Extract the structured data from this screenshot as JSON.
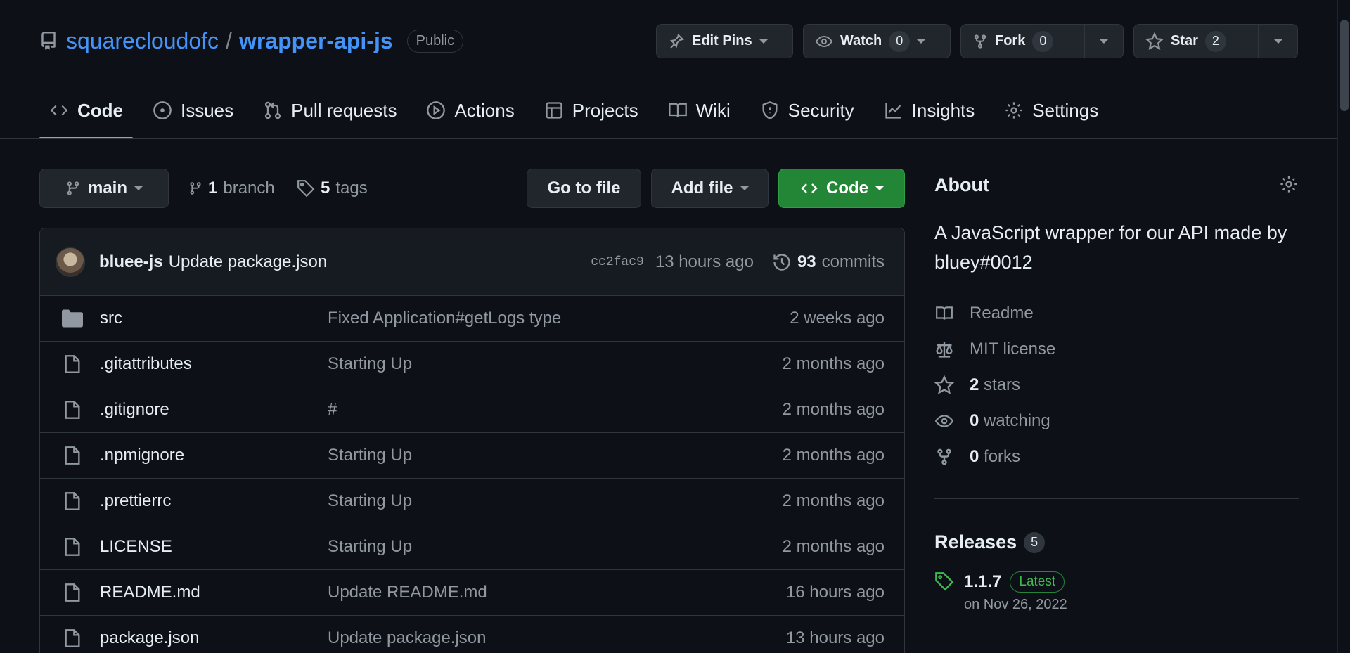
{
  "repo": {
    "owner": "squarecloudofc",
    "separator": "/",
    "name": "wrapper-api-js",
    "visibility": "Public"
  },
  "header_actions": {
    "edit_pins": "Edit Pins",
    "watch": "Watch",
    "watch_count": "0",
    "fork": "Fork",
    "fork_count": "0",
    "star": "Star",
    "star_count": "2"
  },
  "tabs": [
    {
      "label": "Code",
      "icon": "code-icon"
    },
    {
      "label": "Issues",
      "icon": "issue-icon"
    },
    {
      "label": "Pull requests",
      "icon": "pull-request-icon"
    },
    {
      "label": "Actions",
      "icon": "play-icon"
    },
    {
      "label": "Projects",
      "icon": "table-icon"
    },
    {
      "label": "Wiki",
      "icon": "book-icon"
    },
    {
      "label": "Security",
      "icon": "shield-icon"
    },
    {
      "label": "Insights",
      "icon": "graph-icon"
    },
    {
      "label": "Settings",
      "icon": "gear-icon"
    }
  ],
  "toolbar": {
    "branch": "main",
    "branch_count": "1",
    "branch_label": "branch",
    "tag_count": "5",
    "tag_label": "tags",
    "go_to_file": "Go to file",
    "add_file": "Add file",
    "code": "Code"
  },
  "latest_commit": {
    "author": "bluee-js",
    "message": "Update package.json",
    "sha": "cc2fac9",
    "time": "13 hours ago",
    "commit_count": "93",
    "commit_label": "commits"
  },
  "files": [
    {
      "name": "src",
      "type": "folder",
      "message": "Fixed Application#getLogs type",
      "date": "2 weeks ago"
    },
    {
      "name": ".gitattributes",
      "type": "file",
      "message": "Starting Up",
      "date": "2 months ago"
    },
    {
      "name": ".gitignore",
      "type": "file",
      "message": "#",
      "date": "2 months ago"
    },
    {
      "name": ".npmignore",
      "type": "file",
      "message": "Starting Up",
      "date": "2 months ago"
    },
    {
      "name": ".prettierrc",
      "type": "file",
      "message": "Starting Up",
      "date": "2 months ago"
    },
    {
      "name": "LICENSE",
      "type": "file",
      "message": "Starting Up",
      "date": "2 months ago"
    },
    {
      "name": "README.md",
      "type": "file",
      "message": "Update README.md",
      "date": "16 hours ago"
    },
    {
      "name": "package.json",
      "type": "file",
      "message": "Update package.json",
      "date": "13 hours ago"
    }
  ],
  "about": {
    "title": "About",
    "description": "A JavaScript wrapper for our API made by bluey#0012",
    "readme": "Readme",
    "license": "MIT license",
    "stars_count": "2",
    "stars_label": "stars",
    "watching_count": "0",
    "watching_label": "watching",
    "forks_count": "0",
    "forks_label": "forks"
  },
  "releases": {
    "title": "Releases",
    "count": "5",
    "latest_version": "1.1.7",
    "latest_badge": "Latest",
    "latest_date": "on Nov 26, 2022"
  }
}
